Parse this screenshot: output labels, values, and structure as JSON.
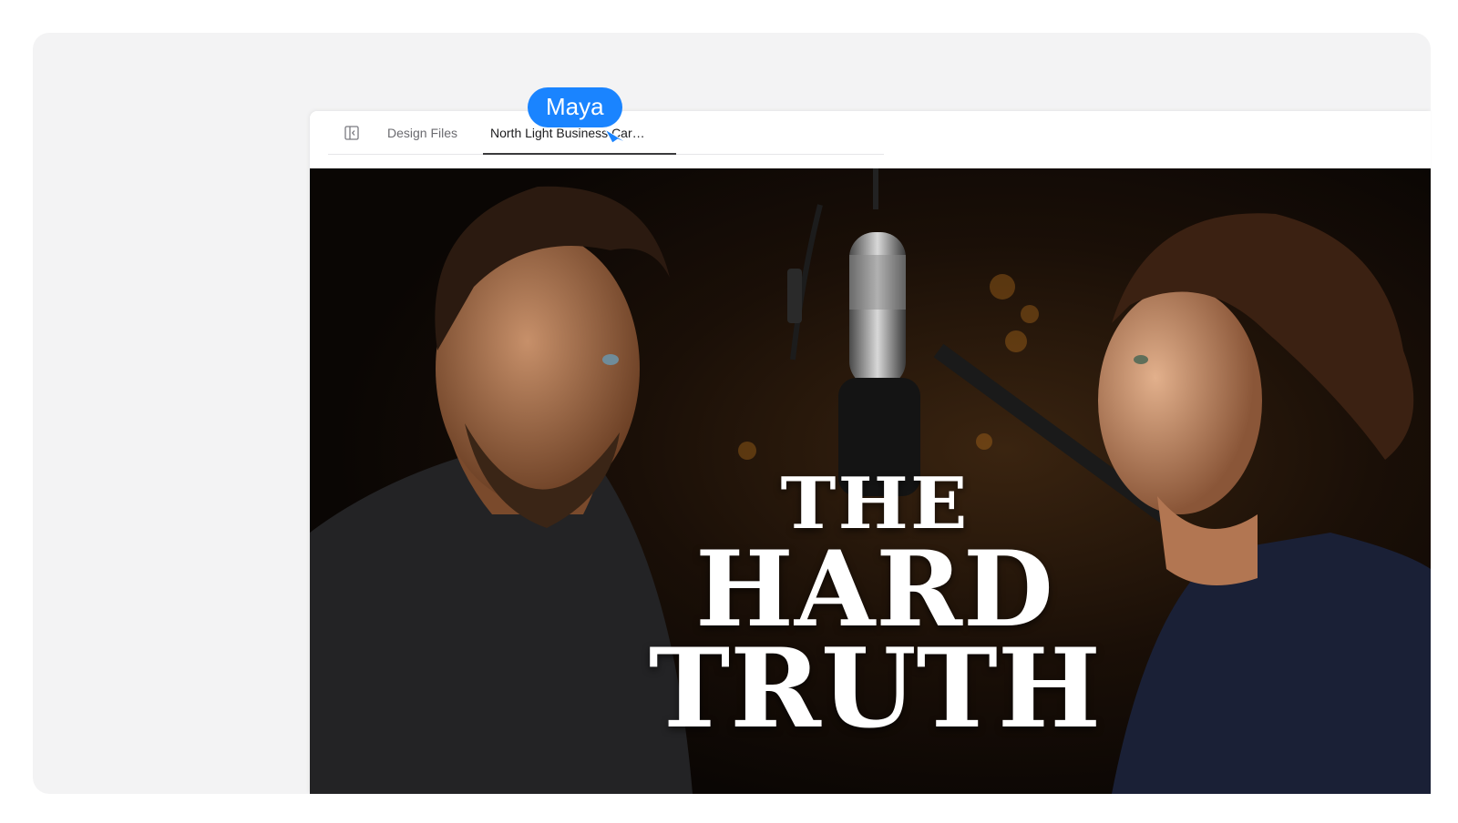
{
  "tabs": [
    {
      "label": "Design Files",
      "active": false
    },
    {
      "label": "North Light Business Car…",
      "active": true
    }
  ],
  "icons": {
    "sidebar_toggle": "sidebar-toggle-icon",
    "cursor": "pointer-arrow-icon"
  },
  "thumbnail": {
    "headline_line1": "THE",
    "headline_line2": "HARD",
    "headline_line3": "TRUTH"
  },
  "collaborator_cursor": {
    "name": "Maya",
    "color": "#1a84ff"
  }
}
